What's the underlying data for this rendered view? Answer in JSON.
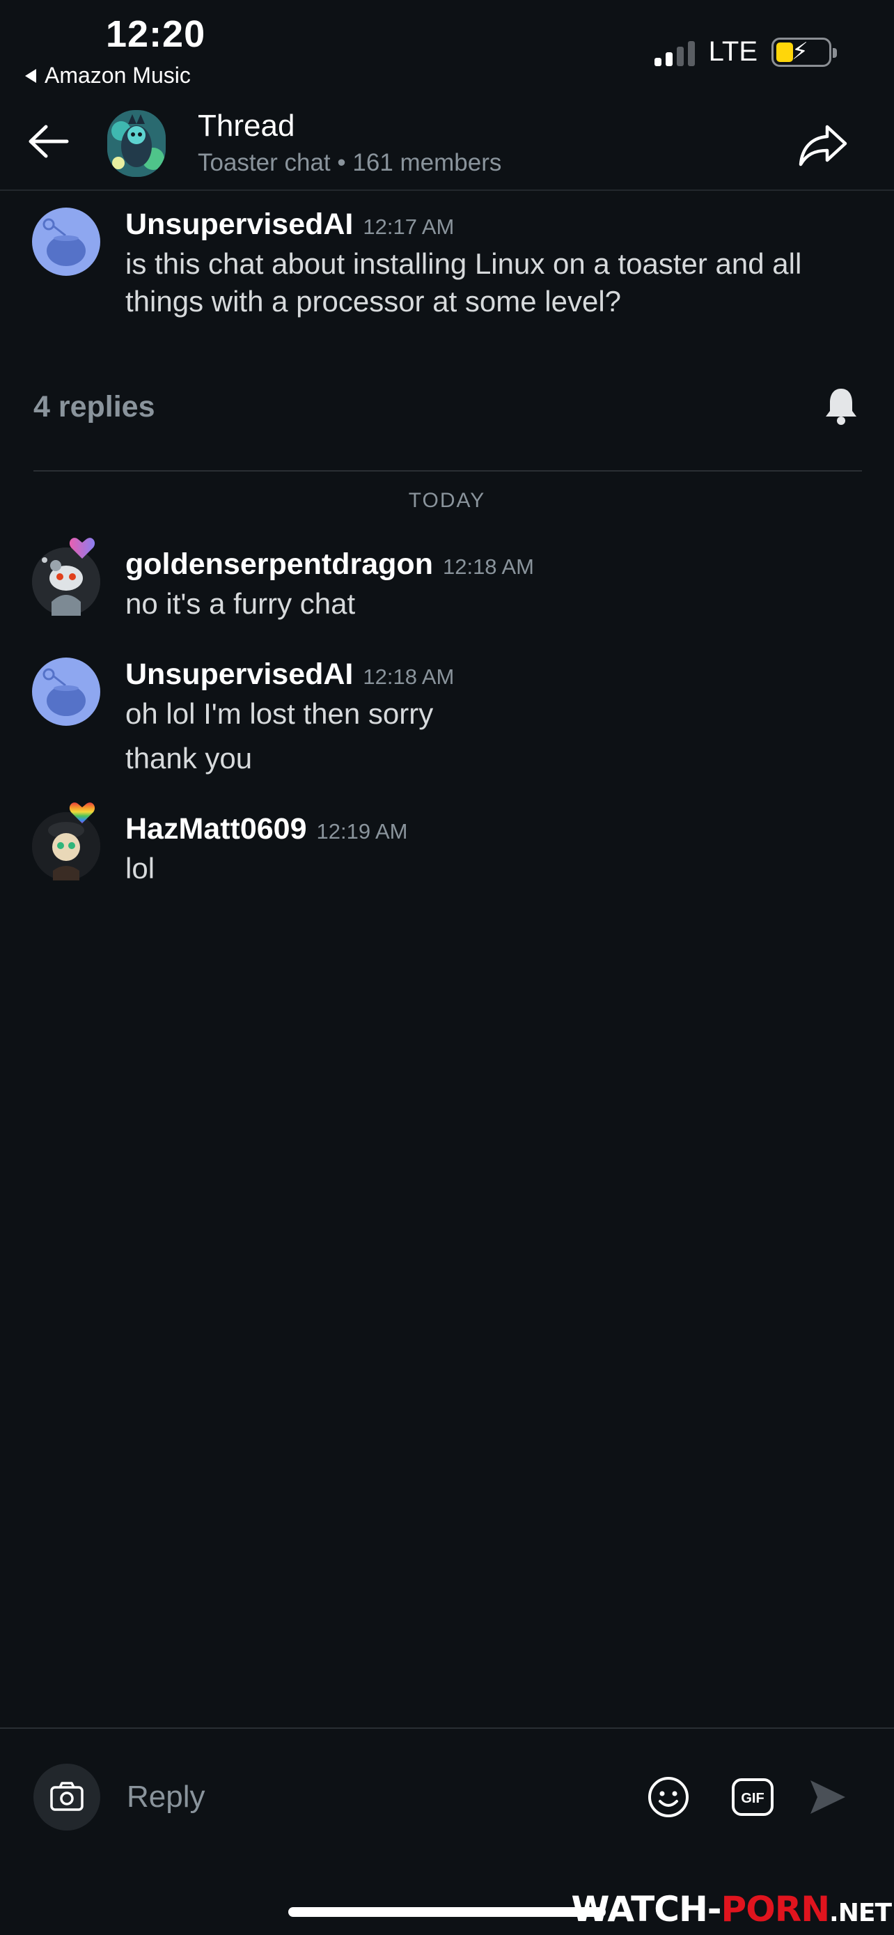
{
  "status_bar": {
    "time": "12:20",
    "back_app": "Amazon Music",
    "network": "LTE"
  },
  "header": {
    "title": "Thread",
    "chat_name": "Toaster chat",
    "separator": "•",
    "members": "161 members"
  },
  "thread_root": {
    "username": "UnsupervisedAI",
    "time": "12:17 AM",
    "text": "is this chat about installing Linux on a toaster and all things with a processor at some level?"
  },
  "replies": {
    "count_label": "4 replies",
    "day_label": "TODAY"
  },
  "messages": [
    {
      "username": "goldenserpentdragon",
      "time": "12:18 AM",
      "lines": [
        "no it's a furry chat"
      ]
    },
    {
      "username": "UnsupervisedAI",
      "time": "12:18 AM",
      "lines": [
        "oh lol I'm lost then sorry",
        "thank you"
      ]
    },
    {
      "username": "HazMatt0609",
      "time": "12:19 AM",
      "lines": [
        "lol"
      ]
    }
  ],
  "composer": {
    "placeholder": "Reply",
    "gif_label": "GIF"
  },
  "watermark": {
    "part1": "WATCH-",
    "part2": "PORN",
    "part3": ".NET"
  },
  "icons": {
    "back": "arrow-left-icon",
    "share": "share-arrow-icon",
    "bell": "bell-icon",
    "camera": "camera-icon",
    "emoji": "smiley-icon",
    "gif": "gif-icon",
    "send": "send-icon"
  },
  "colors": {
    "background": "#0d1115",
    "secondary_text": "#8a949c",
    "avatar_blue": "#8ea7f0",
    "battery_yellow": "#ffd60a"
  }
}
